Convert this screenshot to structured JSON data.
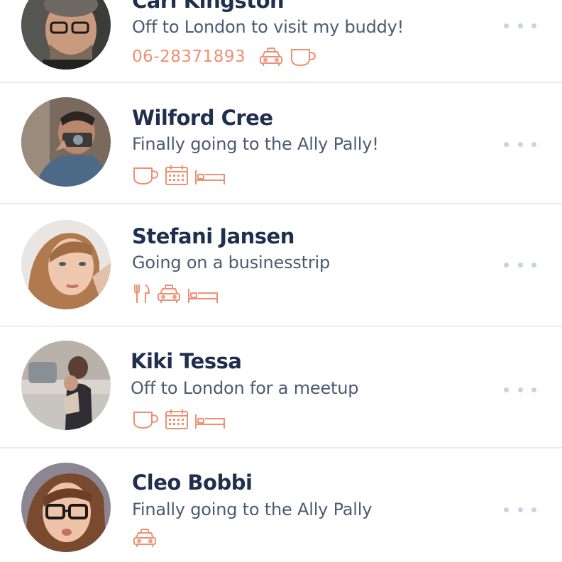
{
  "accent_color": "#ef8f73",
  "contacts": [
    {
      "name": "Carl Kingston",
      "status": "Off to London to visit my buddy!",
      "phone": "06-28371893",
      "icons": [
        "taxi-icon",
        "coffee-cup-icon"
      ]
    },
    {
      "name": "Wilford Cree",
      "status": "Finally going to the Ally Pally!",
      "phone": "",
      "icons": [
        "coffee-cup-icon",
        "calendar-icon",
        "bed-icon"
      ]
    },
    {
      "name": "Stefani Jansen",
      "status": "Going on a businesstrip",
      "phone": "",
      "icons": [
        "fork-knife-icon",
        "taxi-icon",
        "bed-icon"
      ]
    },
    {
      "name": "Kiki Tessa",
      "status": "Off to London for a meetup",
      "phone": "",
      "icons": [
        "coffee-cup-icon",
        "calendar-icon",
        "bed-icon"
      ]
    },
    {
      "name": "Cleo Bobbi",
      "status": "Finally going to the Ally Pally",
      "phone": "",
      "icons": [
        "taxi-icon"
      ]
    }
  ]
}
